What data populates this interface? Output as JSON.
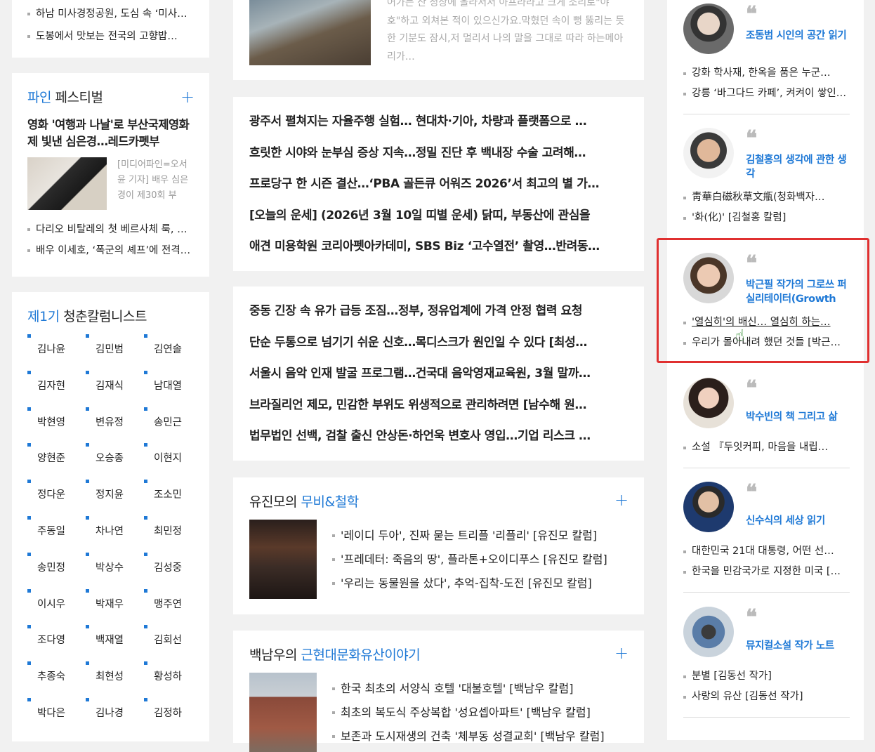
{
  "left_top": {
    "items": [
      "하남 미사경정공원, 도심 속 ‘미사…",
      "도봉에서 맛보는 전국의 고향밥…"
    ]
  },
  "fine_fest": {
    "title_blue": "파인",
    "title_rest": " 페스티벌",
    "plus": "+",
    "headline": "영화 '여행과 나날'로 부산국제영화제 빛낸 심은경…레드카펫부",
    "summary": "[미디어파인=오서윤 기자] 배우 심은경이 제30회 부",
    "items": [
      "다리오 비탈레의 첫 베르사체 룩, …",
      "배우 이세호, ‘폭군의 셰프’에 전격…"
    ]
  },
  "youth": {
    "title_blue": "제1기",
    "title_rest": " 청춘칼럼니스트",
    "names": [
      "김나윤",
      "김민범",
      "김연솔",
      "김자현",
      "김재식",
      "남대열",
      "박현영",
      "변유정",
      "송민근",
      "양현준",
      "오승종",
      "이현지",
      "정다운",
      "정지윤",
      "조소민",
      "주동일",
      "차나연",
      "최민정",
      "송민정",
      "박상수",
      "김성중",
      "이시우",
      "박재우",
      "맹주연",
      "조다영",
      "백재열",
      "김회선",
      "추종숙",
      "최현성",
      "황성하",
      "박다은",
      "김나경",
      "김정하"
    ]
  },
  "mid_top": {
    "text": "어가는 산 정상에 올라서서 아프라라고 크게 소리로\"야호\"하고 외쳐본 적이 있으신가요.막혔던 속이 뻥 뚫리는 듯한 기분도 잠시,저 멀리서 나의 말을 그대로 따라 하는메아리가…"
  },
  "headlist1": [
    "광주서 펼쳐지는 자율주행 실험… 현대차·기아, 차량과 플랫폼으로 …",
    "흐릿한 시야와 눈부심 증상 지속…정밀 진단 후 백내장 수술 고려해…",
    "프로당구 한 시즌 결산…‘PBA 골든큐 어워즈 2026’서 최고의 별 가…",
    "[오늘의 운세] (2026년 3월 10일 띠별 운세) 닭띠, 부동산에 관심을",
    "애견 미용학원 코리아펫아카데미, SBS Biz ‘고수열전’ 촬영…반려동…"
  ],
  "headlist2": [
    "중동 긴장 속 유가 급등 조짐…정부, 정유업계에 가격 안정 협력 요청",
    "단순 두통으로 넘기기 쉬운 신호…목디스크가 원인일 수 있다 [최성…",
    "서울시 음악 인재 발굴 프로그램…건국대 음악영재교육원, 3월 말까…",
    "브라질리언 제모, 민감한 부위도 위생적으로 관리하려면 [남수해 원…",
    "법무법인 선백, 검찰 출신 안상돈·하언욱 변호사 영입…기업 리스크 …"
  ],
  "movie": {
    "title_black": "유진모의 ",
    "title_blue": "무비&철학",
    "plus": "+",
    "items": [
      "'레이디 두아', 진짜 묻는 트리플 '리플리' [유진모 칼럼]",
      "'프레데터: 죽음의 땅', 플라톤+오이디푸스 [유진모 칼럼]",
      "'우리는 동물원을 샀다', 추억-집착-도전 [유진모 칼럼]"
    ]
  },
  "heritage": {
    "title_black": "백남우의 ",
    "title_blue": "근현대문화유산이야기",
    "plus": "+",
    "items": [
      "한국 최초의 서양식 호텔 '대불호텔' [백남우 칼럼]",
      "최초의 복도식 주상복합 '성요셉아파트' [백남우 칼럼]",
      "보존과 도시재생의 건축 '체부동 성결교회' [백남우 칼럼]"
    ]
  },
  "columns": [
    {
      "quote": "❝",
      "name": "조동범 시인의 공간 읽기",
      "items": [
        "강화 학사재, 한옥을 품은 누군…",
        "강릉 ‘바그다드 카페’, 켜켜이 쌓인…"
      ]
    },
    {
      "quote": "❝",
      "name": "김철홍의 생각에 관한 생각",
      "items": [
        "靑華白磁秋草文甁(청화백자…",
        "'화(化)' [김철홍 칼럼]"
      ]
    },
    {
      "quote": "❝",
      "name": "박근필 작가의 그로쓰 퍼실리테이터(Growth",
      "items": [
        "'열심히'의 배신… 열심히 하는…",
        "우리가 몰아내려 했던 것들 [박근…"
      ]
    },
    {
      "quote": "❝",
      "name": "박수빈의 책 그리고 삶",
      "items": [
        "소설 『두잇커피, 마음을 내립…"
      ]
    },
    {
      "quote": "❝",
      "name": "신수식의 세상 읽기",
      "items": [
        "대한민국 21대 대통령, 어떤 선…",
        "한국을 민감국가로 지정한 미국 […"
      ]
    },
    {
      "quote": "❝",
      "name": "뮤지컬소설 작가 노트",
      "items": [
        "분별 [김동선 작가]",
        "사랑의 유산 [김동선 작가]"
      ]
    }
  ],
  "colors": {
    "accent": "#1f79d6",
    "highlight": "#e03030"
  }
}
